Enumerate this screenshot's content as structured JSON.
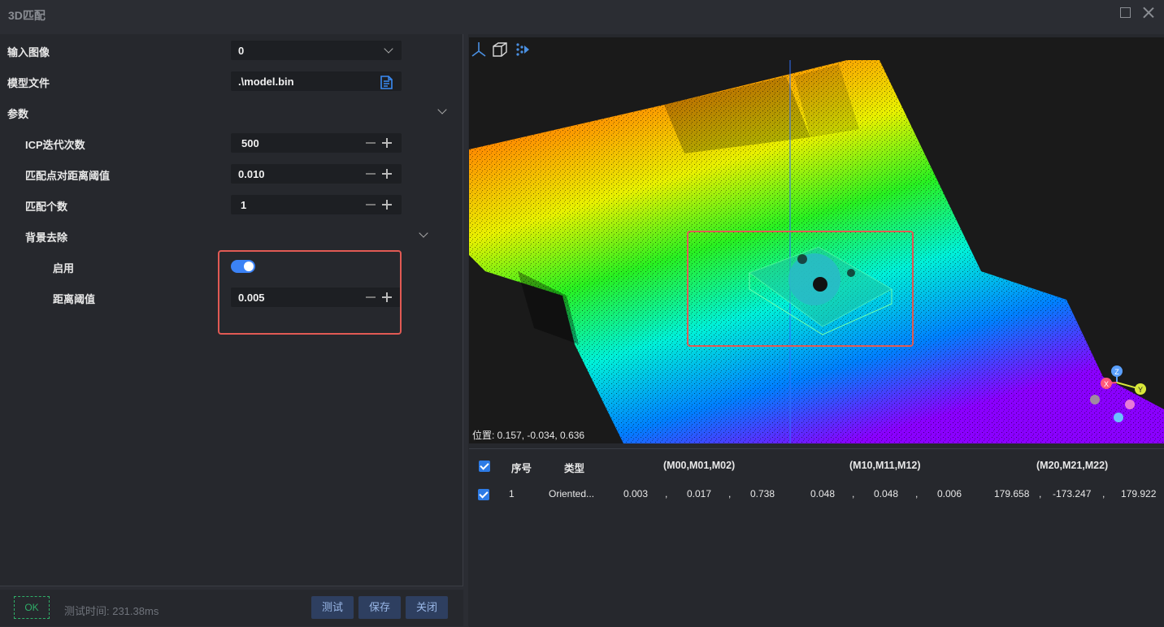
{
  "window": {
    "title": "3D匹配"
  },
  "params": {
    "input_image_label": "输入图像",
    "input_image_value": "0",
    "model_file_label": "模型文件",
    "model_file_value": ".\\model.bin",
    "section_params": "参数",
    "icp_iter_label": "ICP迭代次数",
    "icp_iter_value": "500",
    "dist_threshold_label": "匹配点对距离阈值",
    "dist_threshold_value": "0.010",
    "match_count_label": "匹配个数",
    "match_count_value": "1",
    "section_bg_removal": "背景去除",
    "enable_label": "启用",
    "enable_value": true,
    "bg_dist_label": "距离阈值",
    "bg_dist_value": "0.005"
  },
  "footer": {
    "status": "OK",
    "test_time": "测试时间: 231.38ms",
    "test_button": "测试",
    "save_button": "保存",
    "close_button": "关闭"
  },
  "viewer": {
    "position_readout": "位置: 0.157, -0.034, 0.636",
    "axis_x": "X",
    "axis_y": "Y",
    "axis_z": "Z"
  },
  "results_table": {
    "headers": {
      "index": "序号",
      "type": "类型",
      "m0": "(M00,M01,M02)",
      "m1": "(M10,M11,M12)",
      "m2": "(M20,M21,M22)"
    },
    "separator": ",",
    "rows": [
      {
        "index": "1",
        "type": "Oriented...",
        "m00": "0.003",
        "m01": "0.017",
        "m02": "0.738",
        "m10": "0.048",
        "m11": "0.048",
        "m12": "0.006",
        "m20": "179.658",
        "m21": "-173.247",
        "m22": "179.922"
      }
    ]
  }
}
